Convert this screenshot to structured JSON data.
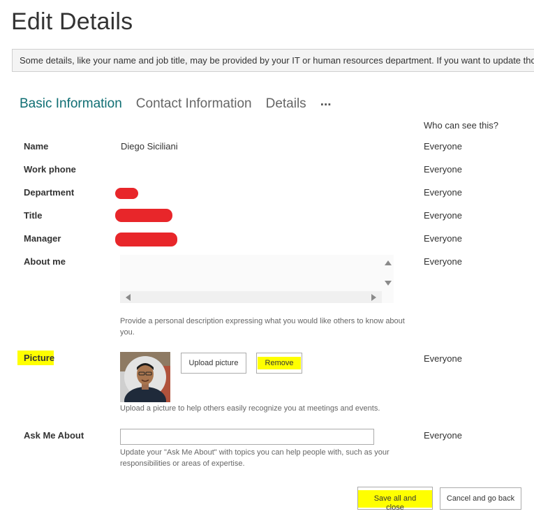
{
  "page": {
    "title": "Edit Details"
  },
  "info_bar": {
    "text": "Some details, like your name and job title, may be provided by your IT or human resources department. If you want to update those details, contact your administrator."
  },
  "tabs": [
    {
      "label": "Basic Information",
      "active": true
    },
    {
      "label": "Contact Information",
      "active": false
    },
    {
      "label": "Details",
      "active": false
    }
  ],
  "tabs_more": "...",
  "visibility_header": "Who can see this?",
  "fields": {
    "name": {
      "label": "Name",
      "value": "Diego Siciliani",
      "visibility": "Everyone"
    },
    "work_phone": {
      "label": "Work phone",
      "value": "",
      "visibility": "Everyone"
    },
    "department": {
      "label": "Department",
      "value_redacted": true,
      "visibility": "Everyone"
    },
    "title": {
      "label": "Title",
      "value_redacted": true,
      "visibility": "Everyone"
    },
    "manager": {
      "label": "Manager",
      "value_redacted": true,
      "visibility": "Everyone"
    },
    "about_me": {
      "label": "About me",
      "value": "",
      "help": "Provide a personal description expressing what you would like others to know about you.",
      "visibility": "Everyone"
    },
    "picture": {
      "label": "Picture",
      "upload_label": "Upload picture",
      "remove_label": "Remove",
      "help": "Upload a picture to help others easily recognize you at meetings and events.",
      "visibility": "Everyone"
    },
    "ask_me_about": {
      "label": "Ask Me About",
      "value": "",
      "help": "Update your \"Ask Me About\" with topics you can help people with, such as your responsibilities or areas of expertise.",
      "visibility": "Everyone"
    }
  },
  "footer": {
    "save_label": "Save all and close",
    "cancel_label": "Cancel and go back"
  },
  "colors": {
    "active_tab": "#0f6e73",
    "highlight": "#ffff00",
    "redaction": "#e8262a"
  }
}
